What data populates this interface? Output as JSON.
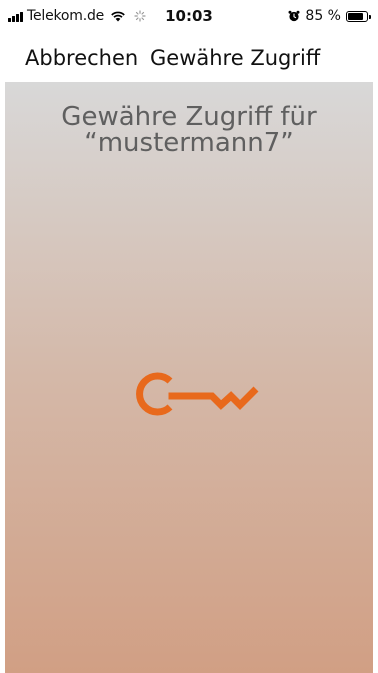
{
  "statusbar": {
    "carrier": "Telekom.de",
    "time": "10:03",
    "battery_percent": "85 %",
    "battery_level": 0.85,
    "icons": [
      "signal-icon",
      "wifi-icon",
      "activity-spinner-icon",
      "alarm-icon",
      "battery-icon"
    ]
  },
  "nav": {
    "cancel_label": "Abbrechen",
    "title": "Gewähre Zugriff"
  },
  "content": {
    "title_line1": "Gewähre Zugriff für",
    "title_line2": "“mustermann7”",
    "icon": "key-icon",
    "accent_color": "#e8691c"
  }
}
